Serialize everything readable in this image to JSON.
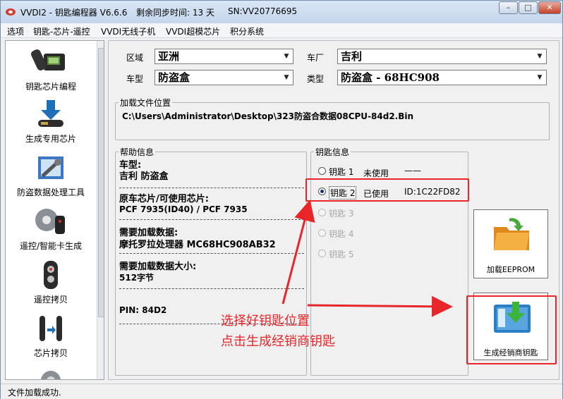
{
  "window": {
    "app_title": "VVDI2 - 钥匙编程器 V6.6.6",
    "sync_time": "剩余同步时间: 13 天",
    "serial": "SN:VV20776695"
  },
  "menu": [
    "选项",
    "钥匙-芯片-遥控",
    "VVDI无线子机",
    "VVDI超模芯片",
    "积分系统"
  ],
  "sidebar": {
    "items": [
      {
        "label": "钥匙芯片编程",
        "icon": "key-chip-icon"
      },
      {
        "label": "生成专用芯片",
        "icon": "download-chip-icon"
      },
      {
        "label": "防盗数据处理工具",
        "icon": "tools-icon"
      },
      {
        "label": "遥控/智能卡生成",
        "icon": "remote-gear-icon"
      },
      {
        "label": "遥控拷贝",
        "icon": "remote-icon"
      },
      {
        "label": "芯片拷贝",
        "icon": "chip-copy-icon"
      }
    ]
  },
  "filters": {
    "region_label": "区域",
    "region_value": "亚洲",
    "maker_label": "车厂",
    "maker_value": "吉利",
    "model_label": "车型",
    "model_value": "防盗盒",
    "type_label": "类型",
    "type_value": "防盗盒 - 68HC908"
  },
  "load_file": {
    "legend": "加载文件位置",
    "path": "C:\\Users\\Administrator\\Desktop\\323防盗合数据08CPU-84d2.Bin"
  },
  "help": {
    "legend": "帮助信息",
    "model_title": "车型:",
    "model_value": "吉利 防盗盒",
    "chip_title": "原车芯片/可使用芯片:",
    "chip_value": "PCF 7935(ID40) / PCF 7935",
    "data_title": "需要加载数据:",
    "data_value": "摩托罗拉处理器 MC68HC908AB32",
    "size_title": "需要加载数据大小:",
    "size_value": "512字节",
    "pin": "PIN: 84D2"
  },
  "key_info": {
    "legend": "钥匙信息",
    "keys": [
      {
        "label": "钥匙 1",
        "status": "未使用",
        "id": "——",
        "selected": false,
        "enabled": true
      },
      {
        "label": "钥匙 2",
        "status": "已使用",
        "id": "ID:1C22FD82",
        "selected": true,
        "enabled": true
      },
      {
        "label": "钥匙 3",
        "status": "",
        "id": "",
        "selected": false,
        "enabled": false
      },
      {
        "label": "钥匙 4",
        "status": "",
        "id": "",
        "selected": false,
        "enabled": false
      },
      {
        "label": "钥匙 5",
        "status": "",
        "id": "",
        "selected": false,
        "enabled": false
      }
    ]
  },
  "buttons": {
    "load_eeprom": "加载EEPROM",
    "generate_dealer_key": "生成经销商钥匙"
  },
  "annotation": {
    "line1": "选择好钥匙位置",
    "line2": "点击生成经销商钥匙",
    "color": "#e8262a"
  },
  "status": "文件加载成功."
}
